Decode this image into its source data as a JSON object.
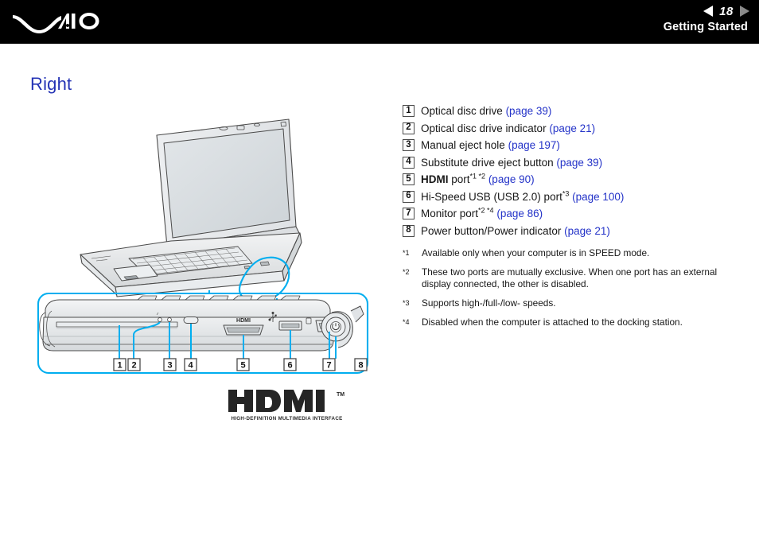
{
  "header": {
    "logo_text": "VAIO",
    "logo_icon": "vaio-logo",
    "page_number": "18",
    "prev_icon": "triangle-left-icon",
    "next_icon": "triangle-right-icon",
    "section_title": "Getting Started"
  },
  "page": {
    "heading": "Right",
    "heading_color": "#2433b5",
    "link_color": "#2433c8",
    "accent_color": "#00aeef"
  },
  "callouts": [
    {
      "num": "1",
      "label": "Optical disc drive",
      "bold": "",
      "sups": "",
      "page_ref": "(page 39)"
    },
    {
      "num": "2",
      "label": "Optical disc drive indicator",
      "bold": "",
      "sups": "",
      "page_ref": "(page 21)"
    },
    {
      "num": "3",
      "label": "Manual eject hole",
      "bold": "",
      "sups": "",
      "page_ref": "(page 197)"
    },
    {
      "num": "4",
      "label": "Substitute drive eject button",
      "bold": "",
      "sups": "",
      "page_ref": "(page 39)"
    },
    {
      "num": "5",
      "label": " port",
      "bold": "HDMI",
      "sups": "*1 *2",
      "page_ref": "(page 90)"
    },
    {
      "num": "6",
      "label": "Hi-Speed USB (USB 2.0) port",
      "bold": "",
      "sups": "*3",
      "page_ref": "(page 100)"
    },
    {
      "num": "7",
      "label": "Monitor port",
      "bold": "",
      "sups": "*2 *4",
      "page_ref": "(page 86)"
    },
    {
      "num": "8",
      "label": "Power button/Power indicator",
      "bold": "",
      "sups": "",
      "page_ref": "(page 21)"
    }
  ],
  "footnotes": [
    {
      "mark": "*1",
      "text": "Available only when your computer is in SPEED mode."
    },
    {
      "mark": "*2",
      "text": "These two ports are mutually exclusive. When one port has an external display connected, the other is disabled."
    },
    {
      "mark": "*3",
      "text": "Supports high-/full-/low- speeds."
    },
    {
      "mark": "*4",
      "text": "Disabled when the computer is attached to the docking station."
    }
  ],
  "figures": {
    "perspective": {
      "name": "laptop-perspective-illustration",
      "highlight_label": "right-edge-highlight"
    },
    "detail": {
      "name": "right-side-detail-illustration",
      "port_labels": {
        "hdmi": "HDMI"
      },
      "callout_numbers": [
        "1",
        "2",
        "3",
        "4",
        "5",
        "6",
        "7",
        "8"
      ]
    },
    "hdmi_logo": {
      "wordmark": "HDMI",
      "trademark": "TM",
      "subtitle": "HIGH-DEFINITION MULTIMEDIA INTERFACE"
    }
  }
}
